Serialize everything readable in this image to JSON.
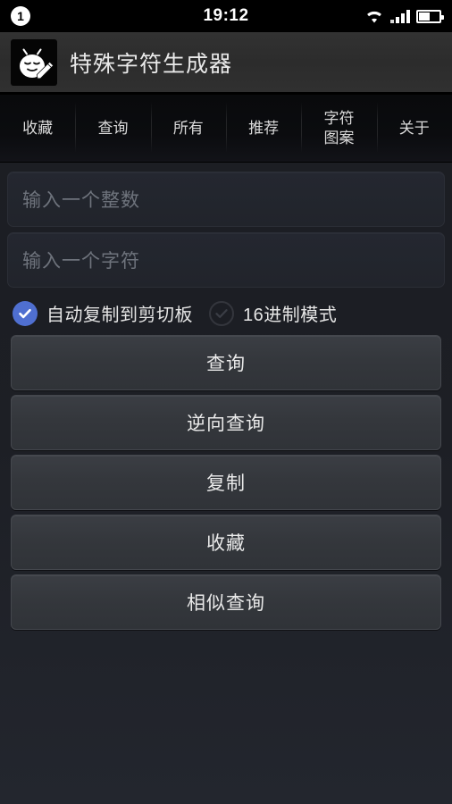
{
  "status_bar": {
    "notification_count": "1",
    "time": "19:12",
    "icons": {
      "wifi": "wifi-icon",
      "signal": "signal-bars-icon",
      "battery": "battery-icon"
    }
  },
  "app_header": {
    "icon": "app-logo-icon",
    "title": "特殊字符生成器"
  },
  "tabs": [
    {
      "label": "收藏",
      "name": "tab-favorites"
    },
    {
      "label": "查询",
      "name": "tab-query"
    },
    {
      "label": "所有",
      "name": "tab-all"
    },
    {
      "label": "推荐",
      "name": "tab-recommend"
    },
    {
      "label": "字符\n图案",
      "name": "tab-char-pattern"
    },
    {
      "label": "关于",
      "name": "tab-about"
    }
  ],
  "form": {
    "integer_input": {
      "value": "",
      "placeholder": "输入一个整数"
    },
    "char_input": {
      "value": "",
      "placeholder": "输入一个字符"
    },
    "checkboxes": [
      {
        "label": "自动复制到剪切板",
        "checked": true
      },
      {
        "label": "16进制模式",
        "checked": false
      }
    ]
  },
  "buttons": [
    {
      "label": "查询",
      "name": "query-button"
    },
    {
      "label": "逆向查询",
      "name": "reverse-query-button"
    },
    {
      "label": "复制",
      "name": "copy-button"
    },
    {
      "label": "收藏",
      "name": "favorite-button"
    },
    {
      "label": "相似查询",
      "name": "similar-query-button"
    }
  ],
  "colors": {
    "accent": "#4f6fd0",
    "background": "#1d1f25",
    "header": "#2e2e2e",
    "tabbar": "#0b0c0f",
    "button": "#35373c",
    "text": "#e6e6e6",
    "placeholder": "#6e737c"
  }
}
